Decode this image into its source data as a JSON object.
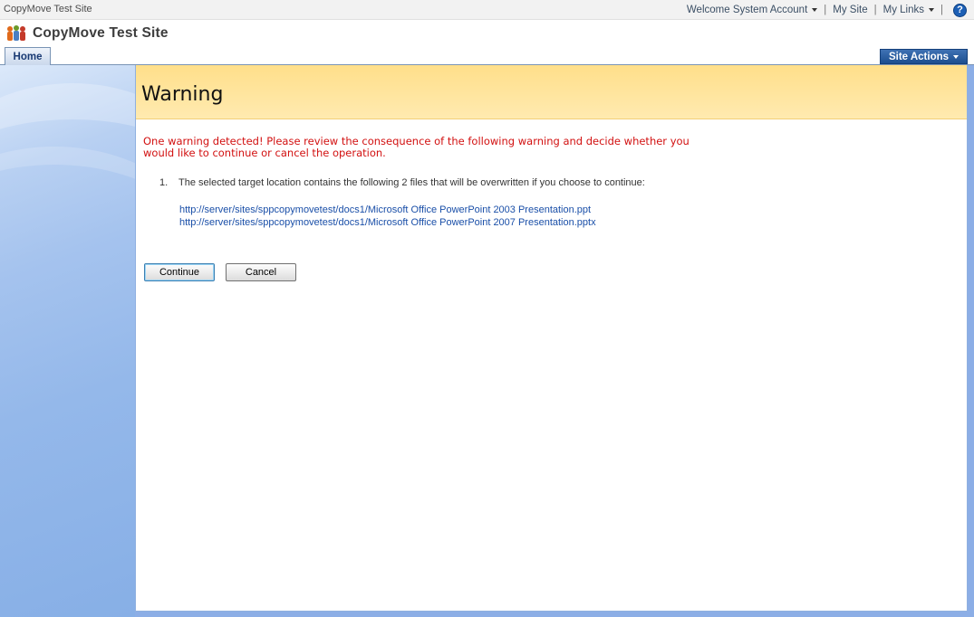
{
  "global_bar": {
    "site_name": "CopyMove Test Site",
    "welcome": "Welcome System Account",
    "my_site": "My Site",
    "my_links": "My Links",
    "separator": "|",
    "help_glyph": "?"
  },
  "header": {
    "site_title": "CopyMove Test Site"
  },
  "nav": {
    "home_tab": "Home",
    "site_actions": "Site Actions"
  },
  "page": {
    "title": "Warning",
    "warning_message": "One warning detected! Please review the consequence of the following warning and decide whether you would like to continue or cancel the operation.",
    "items": [
      {
        "number": "1.",
        "text": "The selected target location contains the following 2 files that will be overwritten if you choose to continue:"
      }
    ],
    "files": [
      "http://server/sites/sppcopymovetest/docs1/Microsoft Office PowerPoint 2003 Presentation.ppt",
      "http://server/sites/sppcopymovetest/docs1/Microsoft Office PowerPoint 2007 Presentation.pptx"
    ],
    "continue_label": "Continue",
    "cancel_label": "Cancel"
  },
  "colors": {
    "warning_text": "#d21010",
    "link": "#1a4fa8",
    "header_band": "#ffdf8a",
    "site_actions_bg": "#1c4e8f"
  },
  "icons": {
    "site_icon": "people-group-icon",
    "help_icon": "help-icon"
  }
}
